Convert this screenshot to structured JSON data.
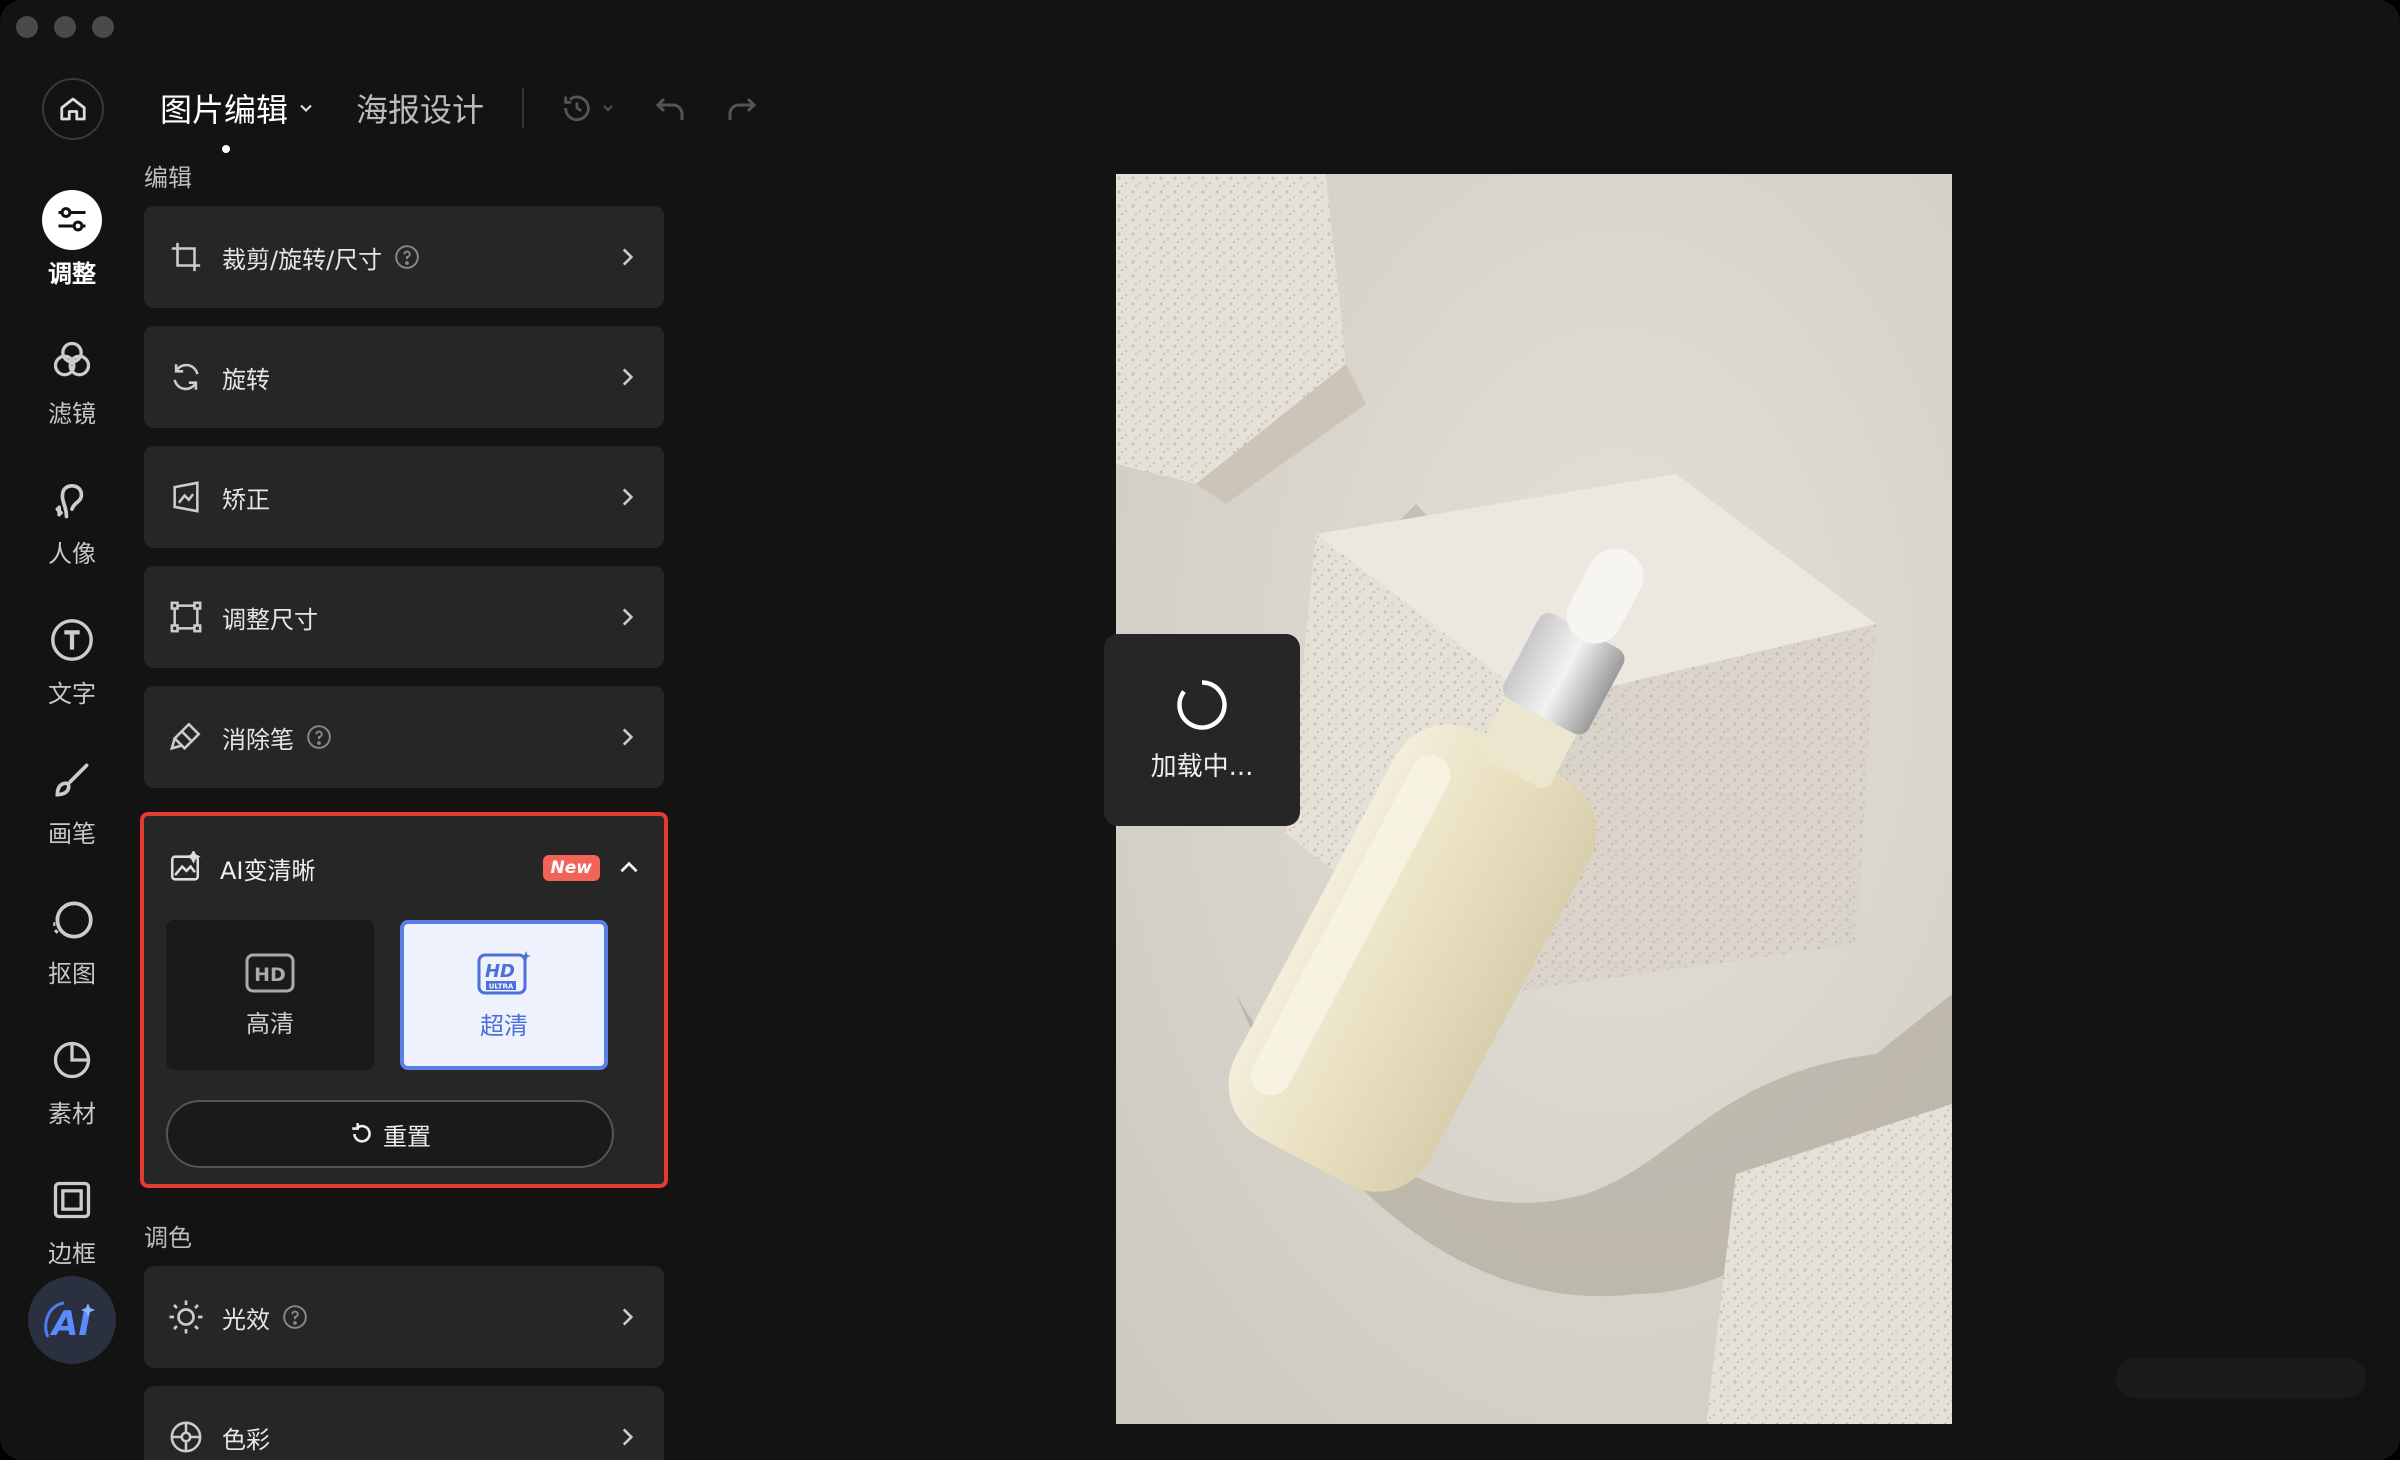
{
  "topbar": {
    "tabs": [
      {
        "label": "图片编辑",
        "active": true,
        "has_dropdown": true
      },
      {
        "label": "海报设计",
        "active": false
      }
    ],
    "icons": [
      "history-icon",
      "undo-icon",
      "redo-icon"
    ]
  },
  "rail": {
    "home_icon": "home-icon",
    "items": [
      {
        "label": "调整",
        "icon": "sliders-icon",
        "active": true
      },
      {
        "label": "滤镜",
        "icon": "filter-circles-icon"
      },
      {
        "label": "人像",
        "icon": "portrait-icon"
      },
      {
        "label": "文字",
        "icon": "text-icon"
      },
      {
        "label": "画笔",
        "icon": "brush-icon"
      },
      {
        "label": "抠图",
        "icon": "cutout-icon"
      },
      {
        "label": "素材",
        "icon": "sticker-icon"
      },
      {
        "label": "边框",
        "icon": "frame-icon"
      }
    ],
    "ai_button": "AI"
  },
  "panel": {
    "edit_section": "编辑",
    "edit_items": [
      {
        "label": "裁剪/旋转/尺寸",
        "icon": "crop-icon",
        "help": true
      },
      {
        "label": "旋转",
        "icon": "rotate-icon",
        "help": false
      },
      {
        "label": "矫正",
        "icon": "perspective-icon",
        "help": false
      },
      {
        "label": "调整尺寸",
        "icon": "resize-icon",
        "help": false
      },
      {
        "label": "消除笔",
        "icon": "eraser-icon",
        "help": true
      }
    ],
    "ai_enhance": {
      "label": "AI变清晰",
      "badge": "New",
      "options": [
        {
          "label": "高清",
          "icon_text": "HD",
          "selected": false
        },
        {
          "label": "超清",
          "icon_text": "HD",
          "icon_subtext": "ULTRA",
          "selected": true
        }
      ],
      "reset_label": "重置"
    },
    "color_section": "调色",
    "color_items": [
      {
        "label": "光效",
        "icon": "light-icon",
        "help": true
      },
      {
        "label": "色彩",
        "icon": "color-wheel-icon",
        "help": false
      }
    ]
  },
  "canvas": {
    "loading_text": "加载中..."
  },
  "colors": {
    "window_bg": "#131313",
    "row_bg": "#262626",
    "highlight_border": "#e53a2e",
    "accent_blue": "#5b7fe6",
    "badge_bg": "#f0645a"
  }
}
